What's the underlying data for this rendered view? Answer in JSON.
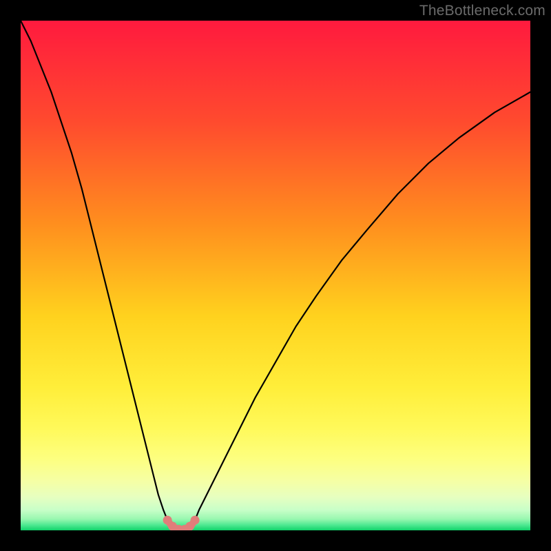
{
  "watermark": "TheBottleneck.com",
  "chart_data": {
    "type": "line",
    "title": "",
    "xlabel": "",
    "ylabel": "",
    "xlim": [
      0,
      100
    ],
    "ylim": [
      0,
      100
    ],
    "gradient_stops": [
      {
        "offset": 0.0,
        "color": "#ff1a3e"
      },
      {
        "offset": 0.2,
        "color": "#ff4b2e"
      },
      {
        "offset": 0.4,
        "color": "#ff8f1e"
      },
      {
        "offset": 0.58,
        "color": "#ffd21e"
      },
      {
        "offset": 0.72,
        "color": "#ffee3a"
      },
      {
        "offset": 0.8,
        "color": "#fff95a"
      },
      {
        "offset": 0.86,
        "color": "#fdff80"
      },
      {
        "offset": 0.905,
        "color": "#f5ffa6"
      },
      {
        "offset": 0.935,
        "color": "#e6ffc0"
      },
      {
        "offset": 0.96,
        "color": "#c8ffc8"
      },
      {
        "offset": 0.978,
        "color": "#98f7b0"
      },
      {
        "offset": 0.99,
        "color": "#4be890"
      },
      {
        "offset": 1.0,
        "color": "#10d26a"
      }
    ],
    "series": [
      {
        "name": "left-branch",
        "stroke": "#000000",
        "stroke_width": 2.2,
        "x": [
          0,
          2,
          4,
          6,
          8,
          10,
          12,
          14,
          16,
          18,
          20,
          22,
          24,
          26,
          27,
          28,
          28.8
        ],
        "y": [
          100,
          96,
          91,
          86,
          80,
          74,
          67,
          59,
          51,
          43,
          35,
          27,
          19,
          11,
          7,
          4,
          2
        ]
      },
      {
        "name": "right-branch",
        "stroke": "#000000",
        "stroke_width": 2.2,
        "x": [
          34.2,
          35,
          36,
          38,
          40,
          43,
          46,
          50,
          54,
          58,
          63,
          68,
          74,
          80,
          86,
          93,
          100
        ],
        "y": [
          2,
          4,
          6,
          10,
          14,
          20,
          26,
          33,
          40,
          46,
          53,
          59,
          66,
          72,
          77,
          82,
          86
        ]
      },
      {
        "name": "bottom-arc",
        "stroke": "#e17d7a",
        "stroke_width": 10,
        "x": [
          28.8,
          29.5,
          30.4,
          31.5,
          32.6,
          33.5,
          34.2
        ],
        "y": [
          2.0,
          1.0,
          0.4,
          0.2,
          0.4,
          1.0,
          2.0
        ]
      }
    ],
    "markers": {
      "name": "arc-dots",
      "fill": "#e17d7a",
      "radius": 6.5,
      "x": [
        28.8,
        29.8,
        31.0,
        32.2,
        33.2,
        34.2
      ],
      "y": [
        2.0,
        0.8,
        0.2,
        0.2,
        0.8,
        2.0
      ]
    }
  }
}
